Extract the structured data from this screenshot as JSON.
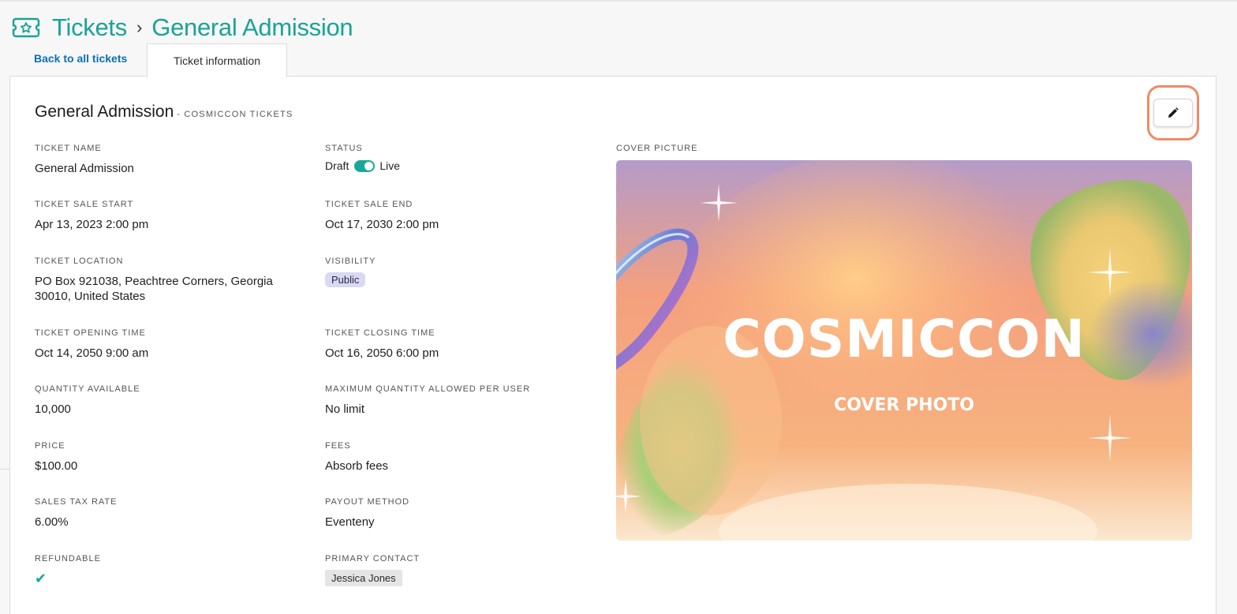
{
  "header": {
    "crumbs": [
      "Tickets",
      "General Admission"
    ],
    "separator": "›"
  },
  "tabs": {
    "back_label": "Back to all tickets",
    "active_label": "Ticket information"
  },
  "ticket": {
    "title": "General Admission",
    "subtitle": "- COSMICCON TICKETS"
  },
  "fields": {
    "ticket_name": {
      "label": "TICKET NAME",
      "value": "General Admission"
    },
    "status": {
      "label": "STATUS",
      "off_label": "Draft",
      "on_label": "Live",
      "is_live": true
    },
    "sale_start": {
      "label": "TICKET SALE START",
      "value": "Apr 13, 2023 2:00 pm"
    },
    "sale_end": {
      "label": "TICKET SALE END",
      "value": "Oct 17, 2030 2:00 pm"
    },
    "location": {
      "label": "TICKET LOCATION",
      "value": "PO Box 921038, Peachtree Corners, Georgia 30010, United States"
    },
    "visibility": {
      "label": "VISIBILITY",
      "value": "Public"
    },
    "opening_time": {
      "label": "TICKET OPENING TIME",
      "value": "Oct 14, 2050 9:00 am"
    },
    "closing_time": {
      "label": "TICKET CLOSING TIME",
      "value": "Oct 16, 2050 6:00 pm"
    },
    "quantity": {
      "label": "QUANTITY AVAILABLE",
      "value": "10,000"
    },
    "max_per_user": {
      "label": "MAXIMUM QUANTITY ALLOWED PER USER",
      "value": "No limit"
    },
    "price": {
      "label": "PRICE",
      "value": "$100.00"
    },
    "fees": {
      "label": "FEES",
      "value": "Absorb fees"
    },
    "tax_rate": {
      "label": "SALES TAX RATE",
      "value": "6.00%"
    },
    "payout": {
      "label": "PAYOUT METHOD",
      "value": "Eventeny"
    },
    "refundable": {
      "label": "REFUNDABLE",
      "value": true
    },
    "primary_contact": {
      "label": "PRIMARY CONTACT",
      "value": "Jessica Jones"
    },
    "cover": {
      "label": "COVER PICTURE",
      "title": "COSMICCON",
      "subtitle": "COVER PHOTO"
    }
  },
  "icons": {
    "header": "ticket-icon",
    "edit": "pencil-icon",
    "refundable": "check-icon"
  },
  "colors": {
    "accent": "#1aa394",
    "link": "#0b6fb8",
    "highlight": "#f08a64"
  }
}
